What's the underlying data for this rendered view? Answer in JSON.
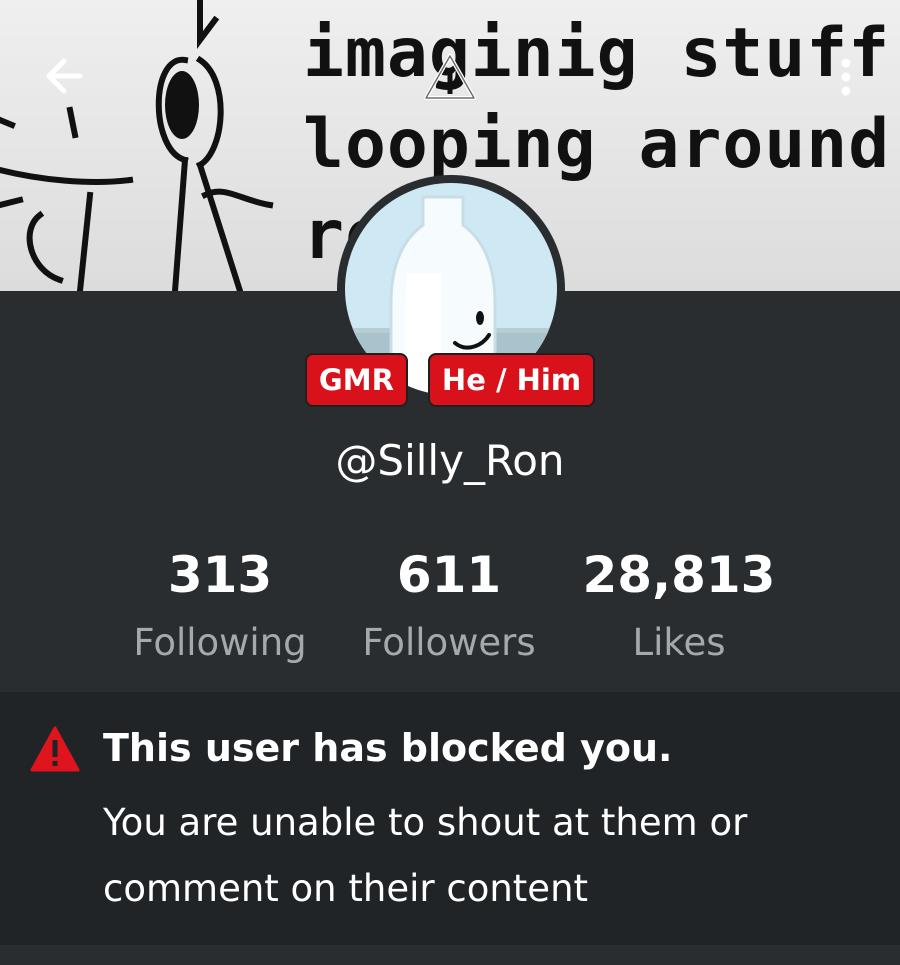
{
  "banner": {
    "lines": [
      "imaginig stuff wh",
      "looping around th",
      "ro"
    ]
  },
  "header": {
    "back_icon": "arrow-left-icon",
    "report_icon": "warning-outline-icon",
    "more_icon": "more-vertical-icon"
  },
  "profile": {
    "badges": [
      "GMR",
      "He / Him"
    ],
    "username": "@Silly_Ron",
    "stats": [
      {
        "value": "313",
        "label": "Following"
      },
      {
        "value": "611",
        "label": "Followers"
      },
      {
        "value": "28,813",
        "label": "Likes"
      }
    ]
  },
  "notice": {
    "icon": "warning-filled-icon",
    "title": "This user has blocked you.",
    "body": "You are unable to shout at them or comment on their content"
  },
  "colors": {
    "accent_red": "#d8111b",
    "background": "#2a2d2f",
    "notice_bg": "#202426"
  }
}
